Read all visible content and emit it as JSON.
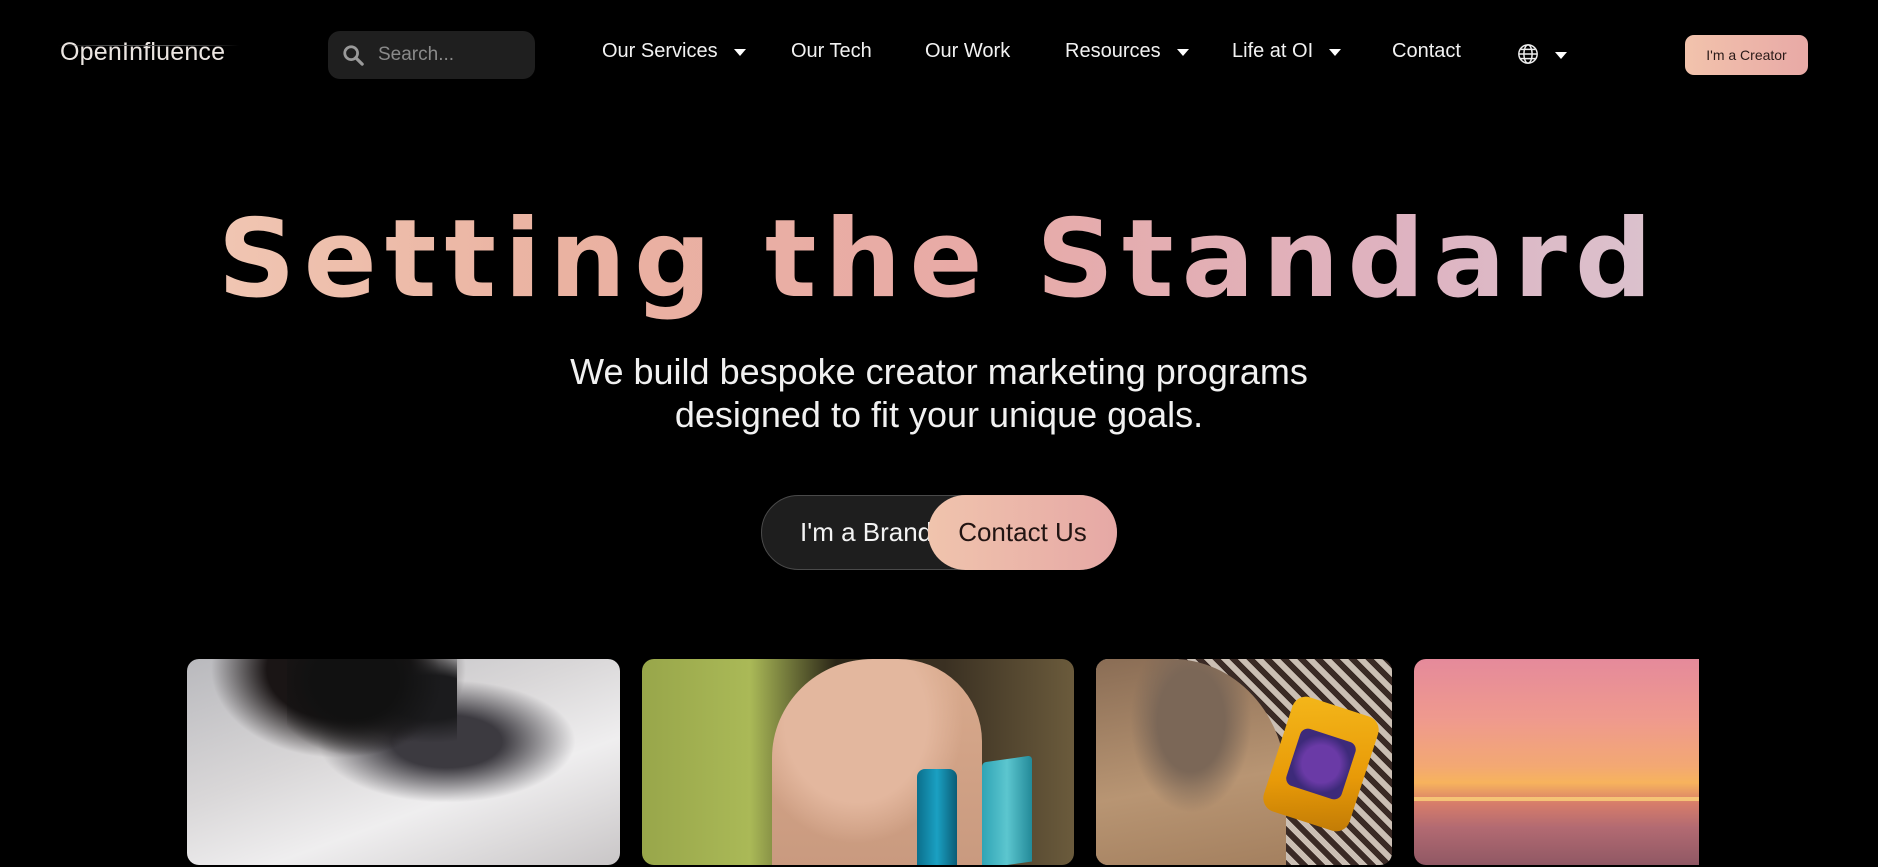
{
  "nav": {
    "logo": "OpenInfluence",
    "search_placeholder": "Search...",
    "items": [
      {
        "label": "Our Services",
        "has_dropdown": true
      },
      {
        "label": "Our Tech",
        "has_dropdown": false
      },
      {
        "label": "Our Work",
        "has_dropdown": false
      },
      {
        "label": "Resources",
        "has_dropdown": true
      },
      {
        "label": "Life at OI",
        "has_dropdown": true
      },
      {
        "label": "Contact",
        "has_dropdown": false
      }
    ],
    "language_icon": "globe-icon",
    "creator_button": "I'm a Creator"
  },
  "hero": {
    "title": "Setting the Standard",
    "subtitle_line1": "We build bespoke creator marketing programs",
    "subtitle_line2": "designed to fit your unique goals.",
    "brand_button": "I'm a Brand",
    "contact_button": "Contact Us"
  },
  "gallery": [
    {
      "name": "cat-closeup"
    },
    {
      "name": "woman-with-products"
    },
    {
      "name": "laundry-detergent"
    },
    {
      "name": "sunset-beach"
    }
  ],
  "colors": {
    "accent_start": "#f2c3ac",
    "accent_end": "#e6a8a5",
    "background": "#000000"
  }
}
